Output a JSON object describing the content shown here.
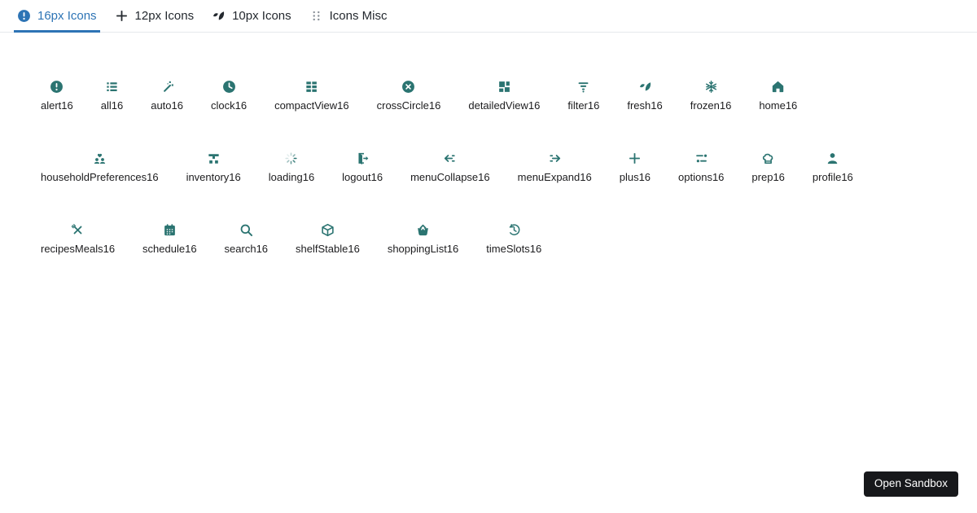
{
  "tabs": [
    {
      "label": "16px Icons",
      "icon": "alert",
      "active": true
    },
    {
      "label": "12px Icons",
      "icon": "plus",
      "active": false
    },
    {
      "label": "10px Icons",
      "icon": "leaf",
      "active": false
    },
    {
      "label": "Icons Misc",
      "icon": "grid-dots",
      "active": false
    }
  ],
  "icon_grid": {
    "items": [
      {
        "label": "alert16",
        "icon": "alert"
      },
      {
        "label": "all16",
        "icon": "list"
      },
      {
        "label": "auto16",
        "icon": "magic-wand"
      },
      {
        "label": "clock16",
        "icon": "clock"
      },
      {
        "label": "compactView16",
        "icon": "compact-view"
      },
      {
        "label": "crossCircle16",
        "icon": "cross-circle"
      },
      {
        "label": "detailedView16",
        "icon": "detailed-view"
      },
      {
        "label": "filter16",
        "icon": "filter"
      },
      {
        "label": "fresh16",
        "icon": "leaf"
      },
      {
        "label": "frozen16",
        "icon": "snowflake"
      },
      {
        "label": "home16",
        "icon": "home"
      },
      {
        "label": "householdPreferences16",
        "icon": "family-heart"
      },
      {
        "label": "inventory16",
        "icon": "hierarchy"
      },
      {
        "label": "loading16",
        "icon": "spinner"
      },
      {
        "label": "logout16",
        "icon": "door-arrow"
      },
      {
        "label": "menuCollapse16",
        "icon": "arrow-left-lines"
      },
      {
        "label": "menuExpand16",
        "icon": "arrow-right-lines"
      },
      {
        "label": "plus16",
        "icon": "plus"
      },
      {
        "label": "options16",
        "icon": "sliders"
      },
      {
        "label": "prep16",
        "icon": "chef-hat"
      },
      {
        "label": "profile16",
        "icon": "person"
      },
      {
        "label": "recipesMeals16",
        "icon": "utensils"
      },
      {
        "label": "schedule16",
        "icon": "calendar"
      },
      {
        "label": "search16",
        "icon": "magnifier"
      },
      {
        "label": "shelfStable16",
        "icon": "cube"
      },
      {
        "label": "shoppingList16",
        "icon": "basket"
      },
      {
        "label": "timeSlots16",
        "icon": "clock-history"
      }
    ]
  },
  "sandbox_button": {
    "label": "Open Sandbox"
  },
  "colors": {
    "icon_teal": "#2b7471",
    "tab_active_blue": "#2d74b5",
    "tab_inactive_text": "#24292f",
    "button_bg": "#17181b",
    "border": "#e5e8ec"
  }
}
